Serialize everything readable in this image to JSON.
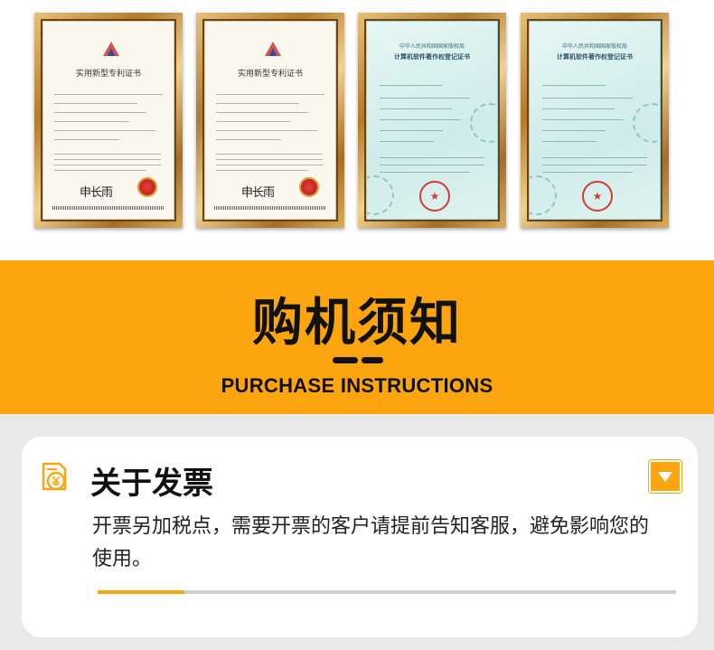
{
  "certificates": [
    {
      "kind": "patent",
      "title": "实用新型专利证书"
    },
    {
      "kind": "patent",
      "title": "实用新型专利证书"
    },
    {
      "kind": "software",
      "header": "中华人民共和国国家版权局",
      "title": "计算机软件著作权登记证书"
    },
    {
      "kind": "software",
      "header": "中华人民共和国国家版权局",
      "title": "计算机软件著作权登记证书"
    }
  ],
  "banner": {
    "title": "购机须知",
    "subtitle": "PURCHASE INSTRUCTIONS",
    "color": "#fca50f"
  },
  "invoice_card": {
    "icon": "invoice-yuan-icon",
    "title": "关于发票",
    "body": "开票另加税点，需要开票的客户请提前告知客服，避免影响您的使用。",
    "toggle_icon": "chevron-down-icon",
    "scroll_progress": 0.15
  }
}
